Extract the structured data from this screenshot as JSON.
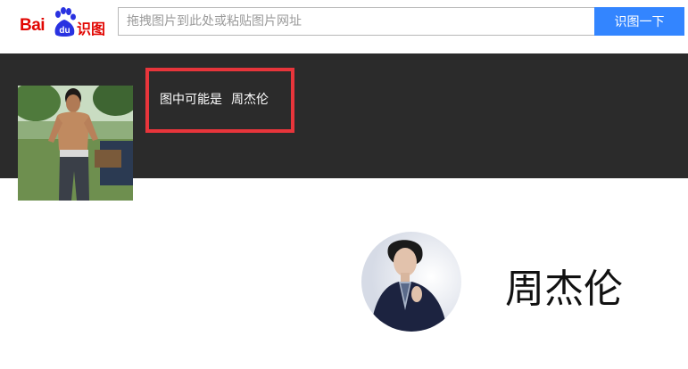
{
  "header": {
    "logo": {
      "text_bai": "Bai",
      "paw_text": "du",
      "text_shitu": "识图",
      "icon": "baidu-paw-icon",
      "brand_color": "#e10602",
      "paw_color": "#2932e1"
    },
    "search": {
      "placeholder": "拖拽图片到此处或粘贴图片网址",
      "value": ""
    },
    "search_button_label": "识图一下",
    "accent": "#3385ff"
  },
  "result": {
    "hint_prefix": "图中可能是",
    "hint_name": "周杰伦",
    "highlight_color": "#e8353b",
    "band_color": "#2b2b2b"
  },
  "celebrity": {
    "name": "周杰伦"
  }
}
